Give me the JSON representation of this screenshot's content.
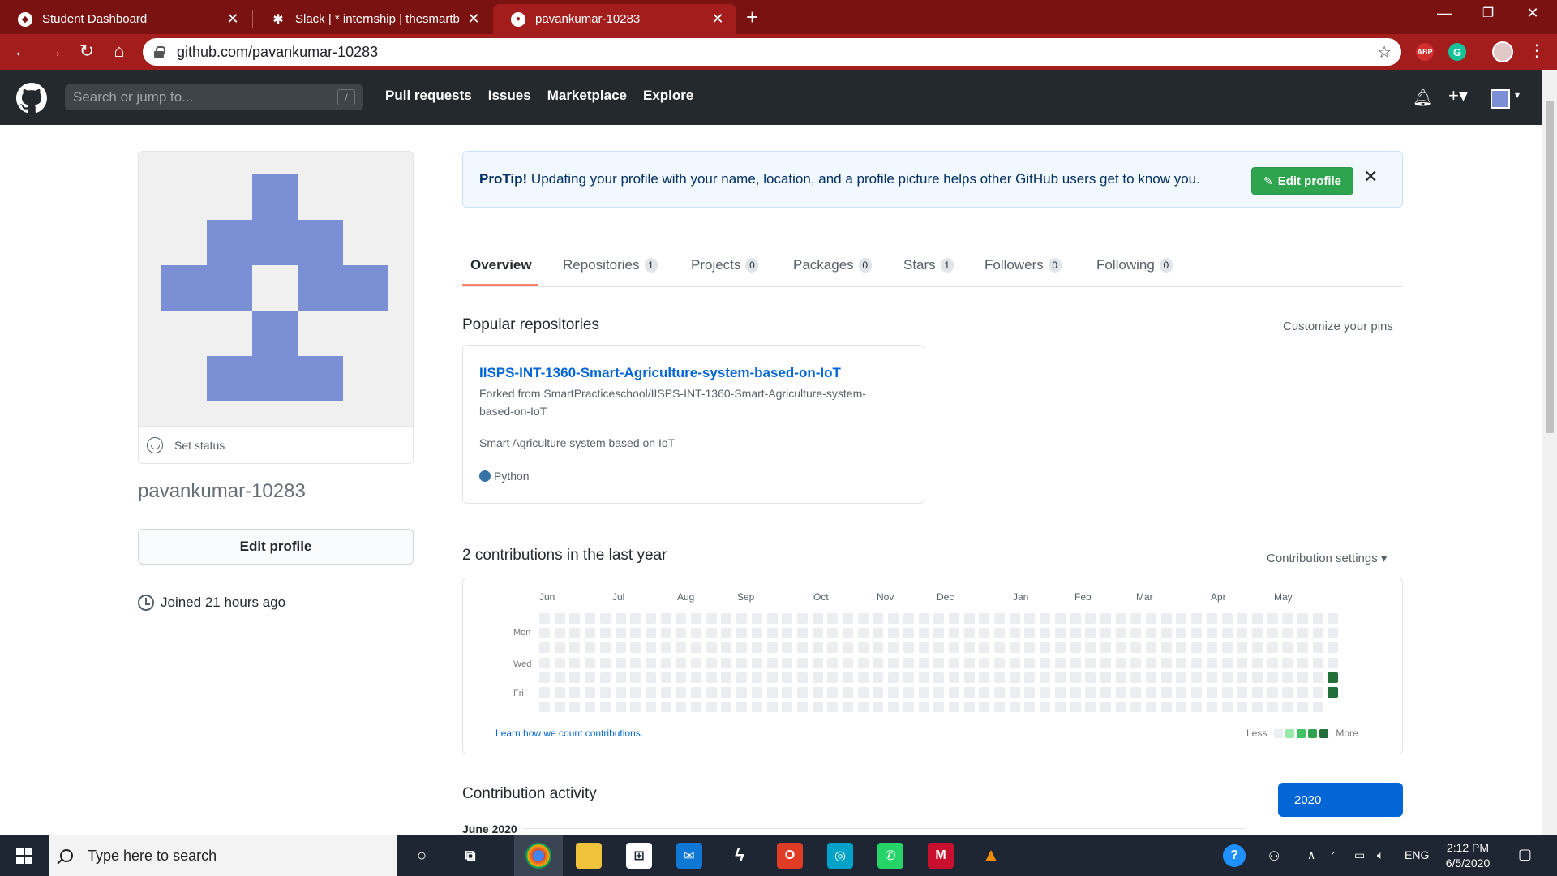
{
  "browser": {
    "tabs": [
      {
        "title": "Student Dashboard",
        "active": false
      },
      {
        "title": "Slack | * internship | thesmartbrid",
        "active": false
      },
      {
        "title": "pavankumar-10283",
        "active": true
      }
    ],
    "url": "github.com/pavankumar-10283",
    "extensions": [
      "ABP",
      "G"
    ]
  },
  "github": {
    "search_placeholder": "Search or jump to...",
    "search_shortcut": "/",
    "nav": [
      "Pull requests",
      "Issues",
      "Marketplace",
      "Explore"
    ]
  },
  "profile": {
    "set_status": "Set status",
    "username": "pavankumar-10283",
    "edit_profile": "Edit profile",
    "joined": "Joined 21 hours ago"
  },
  "protip": {
    "label": "ProTip!",
    "text": " Updating your profile with your name, location, and a profile picture helps other GitHub users get to know you.",
    "button": "Edit profile"
  },
  "tabs": [
    {
      "label": "Overview",
      "count": null
    },
    {
      "label": "Repositories",
      "count": "1"
    },
    {
      "label": "Projects",
      "count": "0"
    },
    {
      "label": "Packages",
      "count": "0"
    },
    {
      "label": "Stars",
      "count": "1"
    },
    {
      "label": "Followers",
      "count": "0"
    },
    {
      "label": "Following",
      "count": "0"
    }
  ],
  "popular": {
    "title": "Popular repositories",
    "customize": "Customize your pins",
    "repo": {
      "name": "IISPS-INT-1360-Smart-Agriculture-system-based-on-IoT",
      "forked_line1": "Forked from SmartPracticeschool/IISPS-INT-1360-Smart-Agriculture-system-",
      "forked_line2": "based-on-IoT",
      "description": "Smart Agriculture system based on IoT",
      "language": "Python",
      "language_color": "#3572A5"
    }
  },
  "contributions": {
    "title": "2 contributions in the last year",
    "settings": "Contribution settings ▾",
    "months": [
      "Jun",
      "Jul",
      "Aug",
      "Sep",
      "Oct",
      "Nov",
      "Dec",
      "Jan",
      "Feb",
      "Mar",
      "Apr",
      "May"
    ],
    "days": [
      "Mon",
      "Wed",
      "Fri"
    ],
    "learn": "Learn how we count contributions.",
    "less": "Less",
    "more": "More",
    "colors": [
      "#ebedf0",
      "#9be9a8",
      "#40c463",
      "#30a14e",
      "#216e39"
    ]
  },
  "activity": {
    "title": "Contribution activity",
    "year": "2020",
    "month_label": "June 2020"
  },
  "taskbar": {
    "search": "Type here to search",
    "lang": "ENG",
    "time": "2:12 PM",
    "date": "6/5/2020"
  }
}
